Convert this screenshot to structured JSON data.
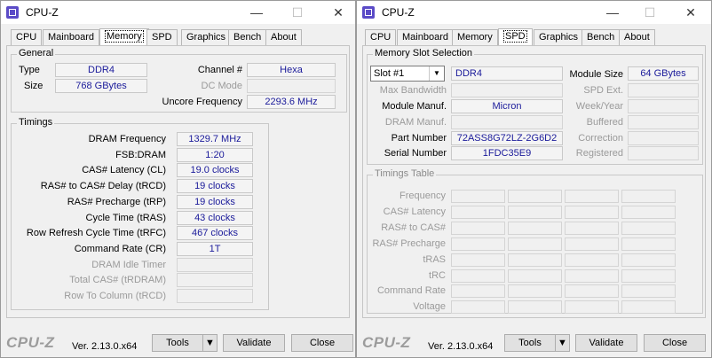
{
  "left": {
    "title": "CPU-Z",
    "tabs": [
      "CPU",
      "Mainboard",
      "Memory",
      "SPD",
      "Graphics",
      "Bench",
      "About"
    ],
    "active_tab": "Memory",
    "general": {
      "title": "General",
      "type_label": "Type",
      "type": "DDR4",
      "size_label": "Size",
      "size": "768 GBytes",
      "channel_label": "Channel #",
      "channel": "Hexa",
      "dcmode_label": "DC Mode",
      "dcmode": "",
      "uncore_label": "Uncore Frequency",
      "uncore": "2293.6 MHz"
    },
    "timings": {
      "title": "Timings",
      "rows": [
        {
          "label": "DRAM Frequency",
          "value": "1329.7 MHz",
          "enabled": true
        },
        {
          "label": "FSB:DRAM",
          "value": "1:20",
          "enabled": true
        },
        {
          "label": "CAS# Latency (CL)",
          "value": "19.0 clocks",
          "enabled": true
        },
        {
          "label": "RAS# to CAS# Delay (tRCD)",
          "value": "19 clocks",
          "enabled": true
        },
        {
          "label": "RAS# Precharge (tRP)",
          "value": "19 clocks",
          "enabled": true
        },
        {
          "label": "Cycle Time (tRAS)",
          "value": "43 clocks",
          "enabled": true
        },
        {
          "label": "Row Refresh Cycle Time (tRFC)",
          "value": "467 clocks",
          "enabled": true
        },
        {
          "label": "Command Rate (CR)",
          "value": "1T",
          "enabled": true
        },
        {
          "label": "DRAM Idle Timer",
          "value": "",
          "enabled": false
        },
        {
          "label": "Total CAS# (tRDRAM)",
          "value": "",
          "enabled": false
        },
        {
          "label": "Row To Column (tRCD)",
          "value": "",
          "enabled": false
        }
      ]
    },
    "footer": {
      "logo": "CPU-Z",
      "version": "Ver. 2.13.0.x64",
      "tools": "Tools",
      "validate": "Validate",
      "close": "Close"
    }
  },
  "right": {
    "title": "CPU-Z",
    "tabs": [
      "CPU",
      "Mainboard",
      "Memory",
      "SPD",
      "Graphics",
      "Bench",
      "About"
    ],
    "active_tab": "SPD",
    "slot": {
      "title": "Memory Slot Selection",
      "selected": "Slot #1",
      "type": "DDR4",
      "module_size_label": "Module Size",
      "module_size": "64 GBytes",
      "max_bw_label": "Max Bandwidth",
      "max_bw": "",
      "spd_ext_label": "SPD Ext.",
      "spd_ext": "",
      "manuf_label": "Module Manuf.",
      "manuf": "Micron",
      "week_label": "Week/Year",
      "week": "",
      "dram_manuf_label": "DRAM Manuf.",
      "dram_manuf": "",
      "buffered_label": "Buffered",
      "buffered": "",
      "part_label": "Part Number",
      "part": "72ASS8G72LZ-2G6D2",
      "correction_label": "Correction",
      "correction": "",
      "serial_label": "Serial Number",
      "serial": "1FDC35E9",
      "registered_label": "Registered",
      "registered": ""
    },
    "timings_table": {
      "title": "Timings Table",
      "rows": [
        "Frequency",
        "CAS# Latency",
        "RAS# to CAS#",
        "RAS# Precharge",
        "tRAS",
        "tRC",
        "Command Rate",
        "Voltage"
      ]
    },
    "footer": {
      "logo": "CPU-Z",
      "version": "Ver. 2.13.0.x64",
      "tools": "Tools",
      "validate": "Validate",
      "close": "Close"
    }
  },
  "colors": {
    "value_text": "#1a1a9a",
    "disabled_text": "#9a9a9a"
  },
  "icons": {
    "minimize": "minimize-icon",
    "maximize": "maximize-icon",
    "close": "close-icon",
    "dropdown": "chevron-down-icon"
  }
}
